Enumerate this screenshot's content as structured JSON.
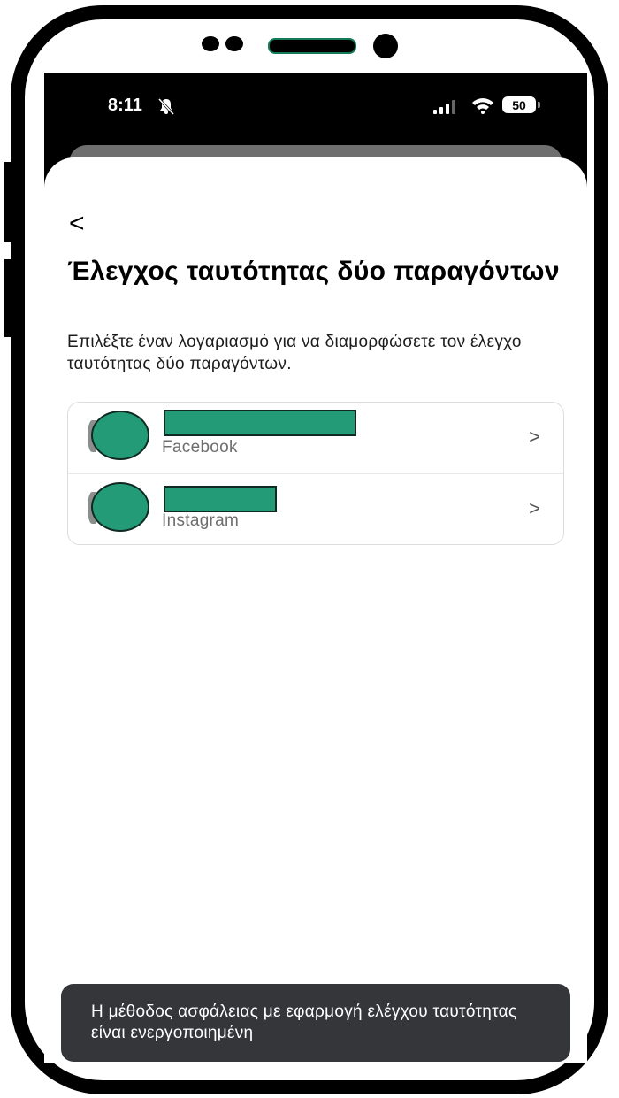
{
  "status_bar": {
    "time": "8:11",
    "battery": "50"
  },
  "header": {
    "back_label": "<",
    "title": "Έλεγχος ταυτότητας δύο παραγόντων",
    "subtitle": "Επιλέξτε έναν λογαριασμό για να διαμορφώσετε τον έλεγχο ταυτότητας δύο παραγόντων."
  },
  "accounts": [
    {
      "platform": "Facebook",
      "chevron": ">"
    },
    {
      "platform": "Instagram",
      "chevron": ">"
    }
  ],
  "toast": {
    "message": "Η μέθοδος ασφάλειας με εφαρμογή ελέγχου ταυτότητας είναι ενεργοποιημένη"
  },
  "colors": {
    "redaction": "#249b77",
    "toast_bg": "#34363a",
    "status_bar_bg": "#000000"
  }
}
